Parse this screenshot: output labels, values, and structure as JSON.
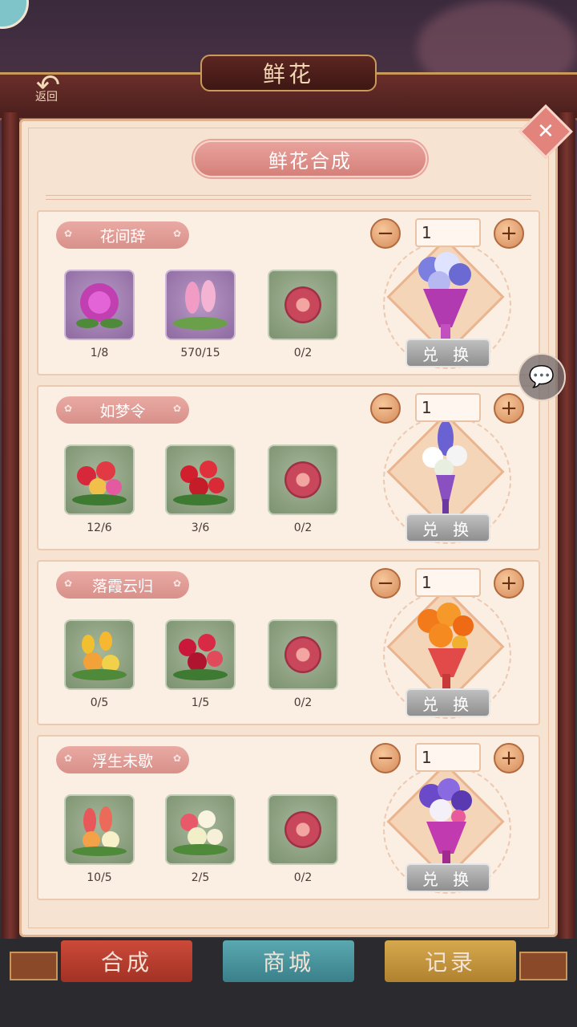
{
  "header": {
    "title": "鲜花",
    "back_icon": "back-arrow-icon",
    "back_label": "返回"
  },
  "panel": {
    "title": "鲜花合成",
    "close_icon": "close-icon"
  },
  "colors": {
    "accent": "#d5807a",
    "panel_bg": "#f7e3d2",
    "redeem_disabled": "#9f9f9f"
  },
  "recipes": [
    {
      "name": "花间辞",
      "ingredients": [
        {
          "icon": "purple-chrysanthemum-icon",
          "count": "1/8"
        },
        {
          "icon": "pink-hyacinth-icon",
          "count": "570/15"
        },
        {
          "icon": "ribbon-icon",
          "count": "0/2"
        }
      ],
      "quantity": "1",
      "bouquet_icon": "blue-hyacinth-bouquet-icon",
      "redeem_label": "兑 换"
    },
    {
      "name": "如梦令",
      "ingredients": [
        {
          "icon": "red-mixed-flowers-icon",
          "count": "12/6"
        },
        {
          "icon": "red-roses-icon",
          "count": "3/6"
        },
        {
          "icon": "ribbon-icon",
          "count": "0/2"
        }
      ],
      "quantity": "1",
      "bouquet_icon": "white-lily-bouquet-icon",
      "redeem_label": "兑 换"
    },
    {
      "name": "落霞云归",
      "ingredients": [
        {
          "icon": "yellow-tulip-icon",
          "count": "0/5"
        },
        {
          "icon": "crimson-flowers-icon",
          "count": "1/5"
        },
        {
          "icon": "ribbon-icon",
          "count": "0/2"
        }
      ],
      "quantity": "1",
      "bouquet_icon": "orange-gerbera-bouquet-icon",
      "redeem_label": "兑 换"
    },
    {
      "name": "浮生未歇",
      "ingredients": [
        {
          "icon": "orange-hyacinth-icon",
          "count": "10/5"
        },
        {
          "icon": "white-lily-icon",
          "count": "2/5"
        },
        {
          "icon": "ribbon-icon",
          "count": "0/2"
        }
      ],
      "quantity": "1",
      "bouquet_icon": "purple-mixed-bouquet-icon",
      "redeem_label": "兑 换"
    }
  ],
  "bottom_tabs": [
    {
      "label": "合成"
    },
    {
      "label": "商城"
    },
    {
      "label": "记录"
    }
  ],
  "chat_icon": "chat-bubble-icon"
}
